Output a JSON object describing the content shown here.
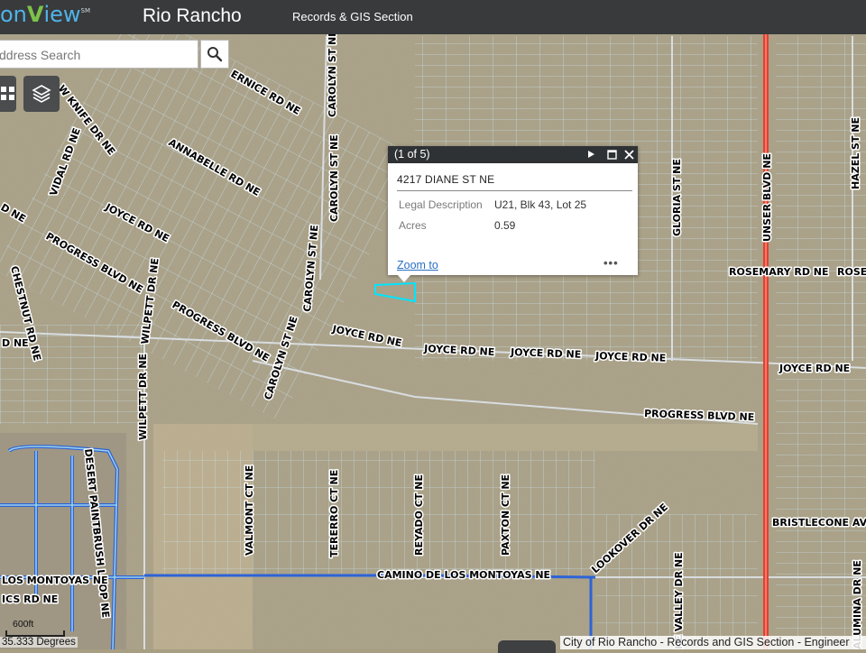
{
  "header": {
    "logo_prefix": "on",
    "logo_v": "V",
    "logo_view": "iew",
    "logo_mark": "SM",
    "title": "Rio Rancho",
    "section": "Records & GIS Section"
  },
  "search": {
    "placeholder": "ddress Search"
  },
  "icons": [
    "search-icon",
    "basemap-gallery-icon",
    "layers-icon",
    "next-arrow-icon",
    "maximize-icon",
    "close-icon",
    "more-icon"
  ],
  "popup": {
    "counter": "(1 of 5)",
    "title": "4217 DIANE ST NE",
    "fields": [
      {
        "label": "Legal Description",
        "value": "U21, Blk 43, Lot 25"
      },
      {
        "label": "Acres",
        "value": "0.59"
      }
    ],
    "zoom_label": "Zoom to",
    "more_label": "•••"
  },
  "streets": [
    "ERNICE RD NE",
    "W KNIFE DR NE",
    "CAROLYN ST NE",
    "ANNABELLE RD NE",
    "VIDAL RD NE",
    "JOYCE RD NE",
    "CAROLYN ST NE",
    "PROGRESS BLVD NE",
    "CHESTNUT RD NE",
    "WILPETT DR NE",
    "PROGRESS BLVD NE",
    "CAROLYN ST NE",
    "JOYCE RD NE",
    "JOYCE RD NE",
    "JOYCE RD NE",
    "JOYCE RD NE",
    "JOYCE RD NE",
    "GLORIA ST NE",
    "UNSER BLVD NE",
    "HAZEL ST NE",
    "ROSEMARY RD NE",
    "ROSE",
    "PROGRESS BLVD NE",
    "CAROLYN ST NE",
    "WILPETT DR NE",
    "DESERT PAINTBRUSH LOOP NE",
    "VALMONT CT NE",
    "TERERRO CT NE",
    "REYADO CT NE",
    "PAXTON CT NE",
    "CAMINO DE LOS MONTOYAS NE",
    "LOOKOVER DR NE",
    "BRISTLECONE AV",
    "KE VALLEY DR NE",
    "ALUMINA DR NE",
    "LOS MONTOYAS NE",
    "ICS RD NE",
    "D NE",
    "D NE",
    "WILPETT DR NE"
  ],
  "scale_label": "600ft",
  "coords_text": "35.333 Degrees",
  "attribution": "City of Rio Rancho - Records and GIS Section - Engineer",
  "colors": {
    "topbar": "#383a3c",
    "parcel_lines": "#c9e4ee",
    "highlight": "#00e5ff",
    "major_road": "#e2412e",
    "water": "#2d63d6"
  }
}
